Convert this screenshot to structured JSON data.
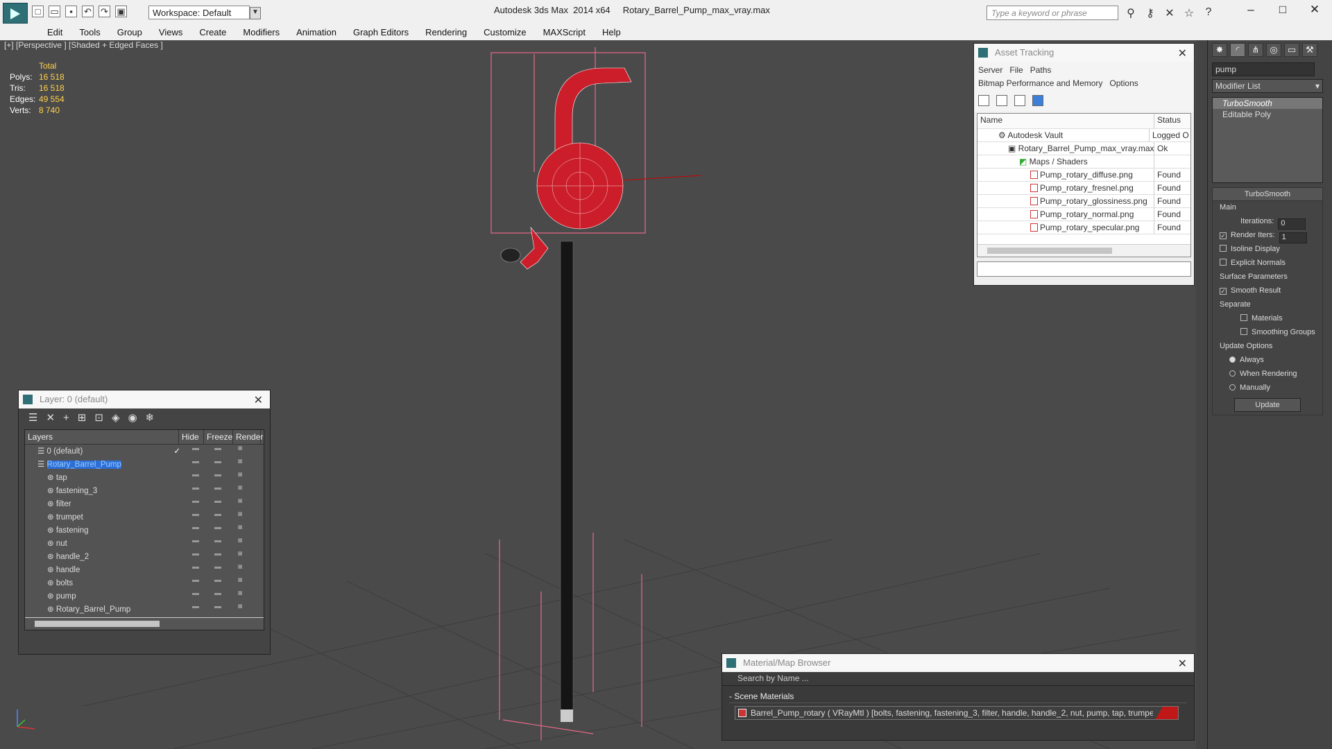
{
  "app": {
    "title": "Autodesk 3ds Max  2014 x64     Rotary_Barrel_Pump_max_vray.max",
    "workspace": "Workspace: Default",
    "search_placeholder": "Type a keyword or phrase"
  },
  "menu": [
    "Edit",
    "Tools",
    "Group",
    "Views",
    "Create",
    "Modifiers",
    "Animation",
    "Graph Editors",
    "Rendering",
    "Customize",
    "MAXScript",
    "Help"
  ],
  "viewport": {
    "label": "[+] [Perspective ] [Shaded + Edged Faces ]",
    "stats_header": "Total",
    "stats": [
      {
        "k": "Polys:",
        "v": "16 518"
      },
      {
        "k": "Tris:",
        "v": "16 518"
      },
      {
        "k": "Edges:",
        "v": "49 554"
      },
      {
        "k": "Verts:",
        "v": "8 740"
      }
    ]
  },
  "asset_tracking": {
    "title": "Asset Tracking",
    "menu1": [
      "Server",
      "File",
      "Paths"
    ],
    "menu2": [
      "Bitmap Performance and Memory",
      "Options"
    ],
    "col_name": "Name",
    "col_status": "Status",
    "rows": [
      {
        "name": "Autodesk Vault",
        "status": "Logged O",
        "indent": 1
      },
      {
        "name": "Rotary_Barrel_Pump_max_vray.max",
        "status": "Ok",
        "indent": 2
      },
      {
        "name": "Maps / Shaders",
        "status": "",
        "indent": 3
      },
      {
        "name": "Pump_rotary_diffuse.png",
        "status": "Found",
        "indent": 4
      },
      {
        "name": "Pump_rotary_fresnel.png",
        "status": "Found",
        "indent": 4
      },
      {
        "name": "Pump_rotary_glossiness.png",
        "status": "Found",
        "indent": 4
      },
      {
        "name": "Pump_rotary_normal.png",
        "status": "Found",
        "indent": 4
      },
      {
        "name": "Pump_rotary_specular.png",
        "status": "Found",
        "indent": 4
      }
    ]
  },
  "layers": {
    "title": "Layer: 0 (default)",
    "col_layers": "Layers",
    "col_hide": "Hide",
    "col_freeze": "Freeze",
    "col_render": "Render",
    "rows": [
      {
        "name": "0 (default)",
        "level": 0,
        "selected": false
      },
      {
        "name": "Rotary_Barrel_Pump",
        "level": 0,
        "selected": true
      },
      {
        "name": "tap",
        "level": 1
      },
      {
        "name": "fastening_3",
        "level": 1
      },
      {
        "name": "filter",
        "level": 1
      },
      {
        "name": "trumpet",
        "level": 1
      },
      {
        "name": "fastening",
        "level": 1
      },
      {
        "name": "nut",
        "level": 1
      },
      {
        "name": "handle_2",
        "level": 1
      },
      {
        "name": "handle",
        "level": 1
      },
      {
        "name": "bolts",
        "level": 1
      },
      {
        "name": "pump",
        "level": 1
      },
      {
        "name": "Rotary_Barrel_Pump",
        "level": 1
      }
    ]
  },
  "material_browser": {
    "title": "Material/Map Browser",
    "search_placeholder": "Search by Name ...",
    "section": "- Scene Materials",
    "material": "Barrel_Pump_rotary  ( VRayMtl )  [bolts, fastening, fastening_3, filter, handle, handle_2, nut, pump, tap, trumpet]"
  },
  "command_panel": {
    "search_value": "pump",
    "modifier_list": "Modifier List",
    "stack": [
      "TurboSmooth",
      "Editable Poly"
    ],
    "rollout_title": "TurboSmooth",
    "main": "Main",
    "iterations_label": "Iterations:",
    "iterations_value": "0",
    "render_iters_label": "Render Iters:",
    "render_iters_value": "1",
    "isoline": "Isoline Display",
    "explicit_normals": "Explicit Normals",
    "surface_params": "Surface Parameters",
    "smooth_result": "Smooth Result",
    "separate": "Separate",
    "materials": "Materials",
    "smoothing_groups": "Smoothing Groups",
    "update_options": "Update Options",
    "always": "Always",
    "when_rendering": "When Rendering",
    "manually": "Manually",
    "update_button": "Update"
  }
}
